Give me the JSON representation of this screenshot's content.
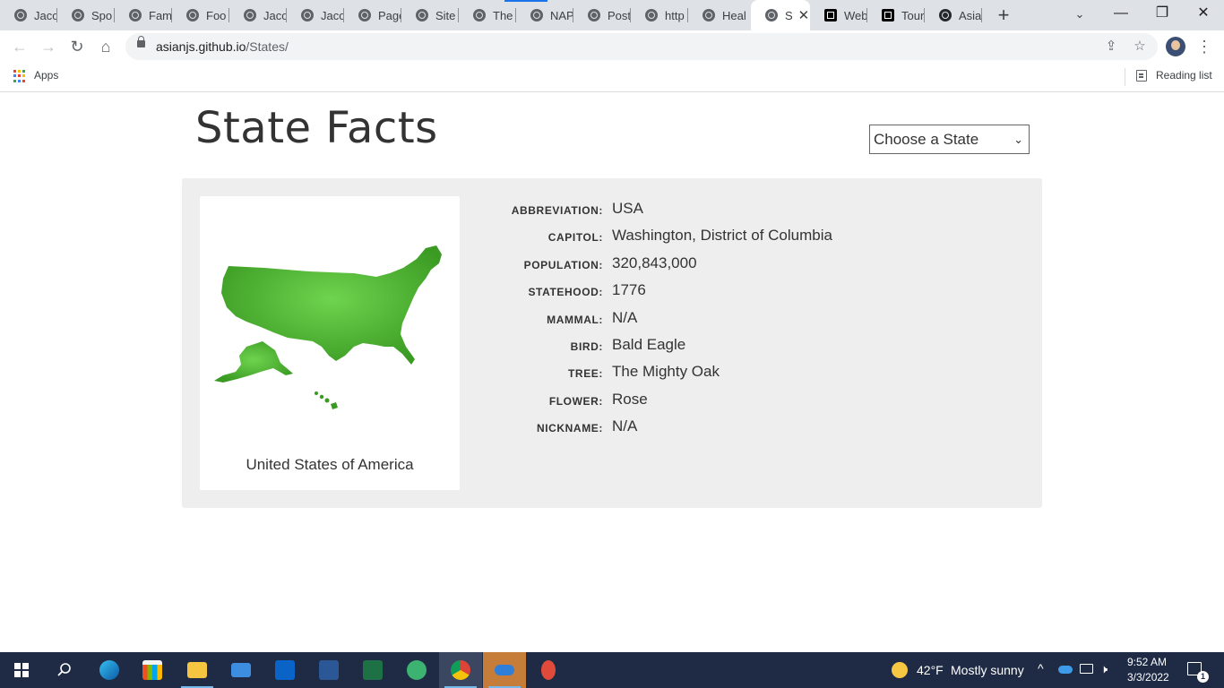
{
  "browser": {
    "tabs": [
      {
        "label": "Jaco",
        "icon": "globe-icon"
      },
      {
        "label": "Spo",
        "icon": "globe-icon"
      },
      {
        "label": "Fam",
        "icon": "globe-icon"
      },
      {
        "label": "Foo",
        "icon": "globe-icon"
      },
      {
        "label": "Jaco",
        "icon": "globe-icon"
      },
      {
        "label": "Jaco",
        "icon": "globe-icon"
      },
      {
        "label": "Page",
        "icon": "globe-icon"
      },
      {
        "label": "Site",
        "icon": "globe-icon"
      },
      {
        "label": "The",
        "icon": "globe-icon"
      },
      {
        "label": "NAP",
        "icon": "globe-icon"
      },
      {
        "label": "Post",
        "icon": "globe-icon"
      },
      {
        "label": "http",
        "icon": "globe-icon"
      },
      {
        "label": "Heal",
        "icon": "globe-icon"
      },
      {
        "label": "S",
        "icon": "globe-icon",
        "active": true
      },
      {
        "label": "Web",
        "icon": "square-icon"
      },
      {
        "label": "Tour",
        "icon": "square-icon"
      },
      {
        "label": "Asia",
        "icon": "github-icon"
      }
    ],
    "url_host": "asianjs.github.io",
    "url_path": "/States/",
    "bookmarks": {
      "apps_label": "Apps",
      "reading_list_label": "Reading list"
    }
  },
  "page": {
    "title": "State Facts",
    "select": {
      "selected": "Choose a State",
      "options": [
        "Choose a State"
      ]
    },
    "country_name": "United States of America",
    "facts": [
      {
        "key": "ABBREVIATION:",
        "value": "USA"
      },
      {
        "key": "CAPITOL:",
        "value": "Washington, District of Columbia"
      },
      {
        "key": "POPULATION:",
        "value": "320,843,000"
      },
      {
        "key": "STATEHOOD:",
        "value": "1776"
      },
      {
        "key": "MAMMAL:",
        "value": "N/A"
      },
      {
        "key": "BIRD:",
        "value": "Bald Eagle"
      },
      {
        "key": "TREE:",
        "value": "The Mighty Oak"
      },
      {
        "key": "FLOWER:",
        "value": "Rose"
      },
      {
        "key": "NICKNAME:",
        "value": "N/A"
      }
    ],
    "map_color": "#4caf32"
  },
  "taskbar": {
    "weather_temp": "42°F",
    "weather_desc": "Mostly sunny",
    "time": "9:52 AM",
    "date": "3/3/2022",
    "notification_count": "1"
  }
}
